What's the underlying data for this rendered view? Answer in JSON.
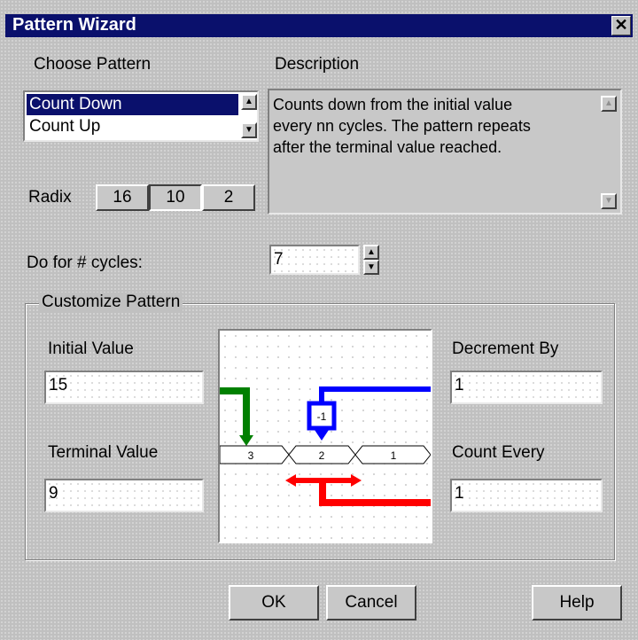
{
  "window": {
    "title": "Pattern Wizard",
    "close_glyph": "✕"
  },
  "choose_pattern": {
    "label": "Choose Pattern",
    "items": [
      {
        "label": "Count Down",
        "selected": true
      },
      {
        "label": "Count Up",
        "selected": false
      }
    ]
  },
  "description": {
    "label": "Description",
    "lines": [
      "Counts down from the initial value",
      "every nn cycles.  The pattern repeats",
      "after the terminal value reached."
    ]
  },
  "radix": {
    "label": "Radix",
    "options": [
      "16",
      "10",
      "2"
    ],
    "selected": "10"
  },
  "cycles": {
    "label": "Do for # cycles:",
    "value": "7"
  },
  "customize": {
    "title": "Customize Pattern",
    "initial_value": {
      "label": "Initial Value",
      "value": "15"
    },
    "terminal_value": {
      "label": "Terminal Value",
      "value": "9"
    },
    "decrement_by": {
      "label": "Decrement By",
      "value": "1"
    },
    "count_every": {
      "label": "Count Every",
      "value": "1"
    },
    "diagram": {
      "segments": [
        "3",
        "2",
        "1"
      ],
      "decrement_box": "-1",
      "colors": {
        "initial": "#008000",
        "decrement": "#0000ff",
        "count_every": "#ff0000"
      }
    }
  },
  "buttons": {
    "ok": "OK",
    "cancel": "Cancel",
    "help": "Help"
  },
  "icons": {
    "scroll_up": "▲",
    "scroll_down": "▼"
  }
}
